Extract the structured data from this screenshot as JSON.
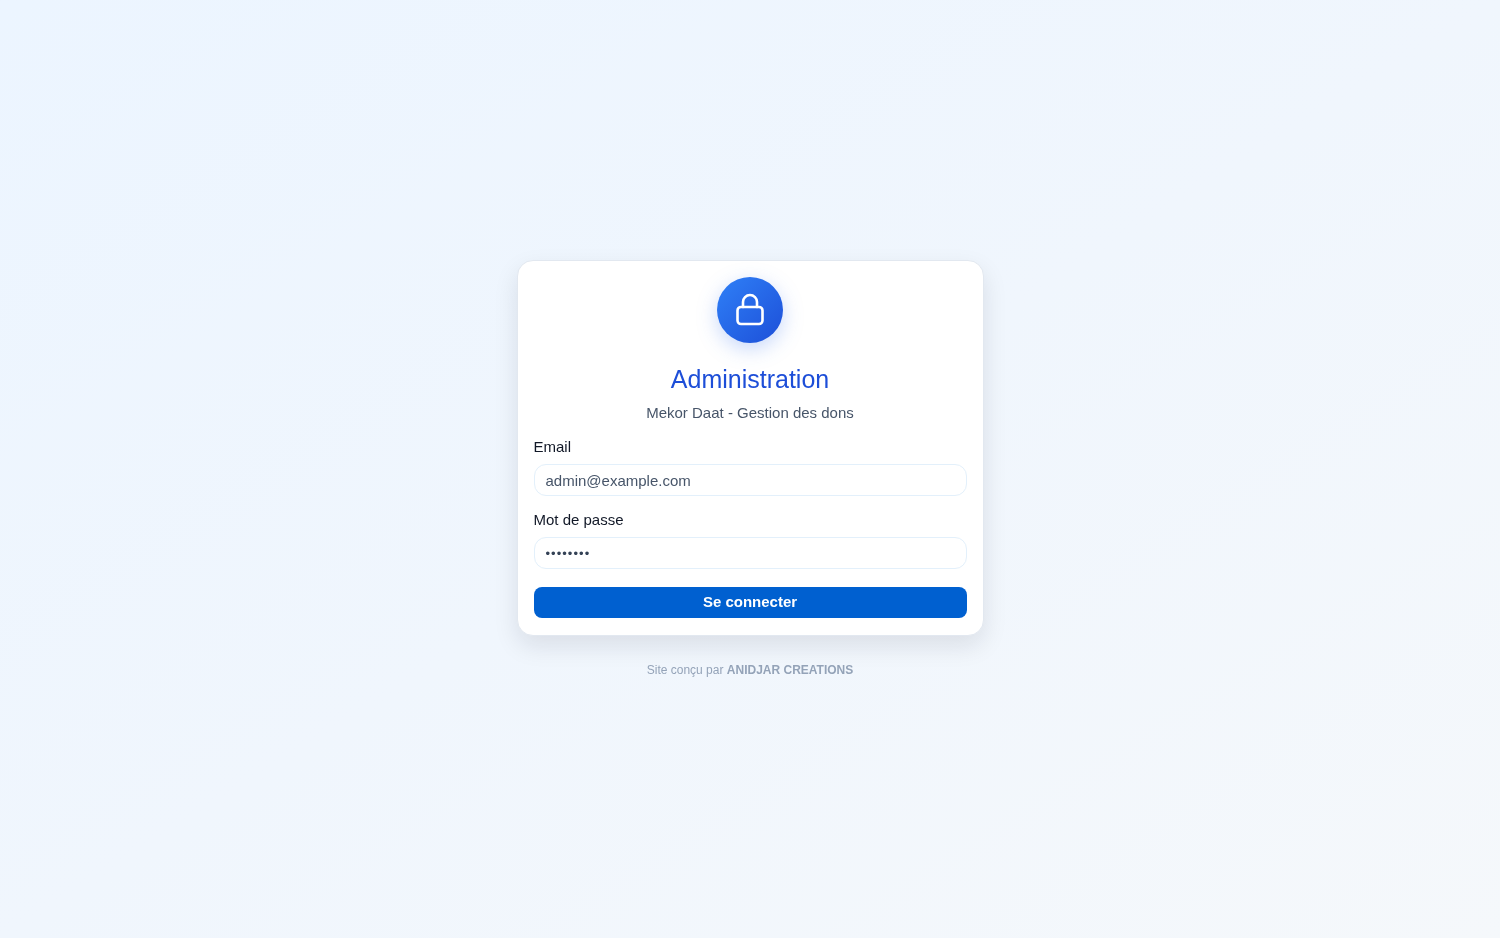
{
  "header": {
    "title": "Administration",
    "subtitle": "Mekor Daat - Gestion des dons"
  },
  "form": {
    "fields": [
      {
        "kind": "text",
        "label": "Email",
        "value": "admin@example.com"
      },
      {
        "kind": "password",
        "label": "Mot de passe",
        "value": "••••••••"
      }
    ],
    "submit": "Se connecter"
  },
  "footer": {
    "credit": "Site conçu par **ANIDJAR CREATIONS**"
  }
}
